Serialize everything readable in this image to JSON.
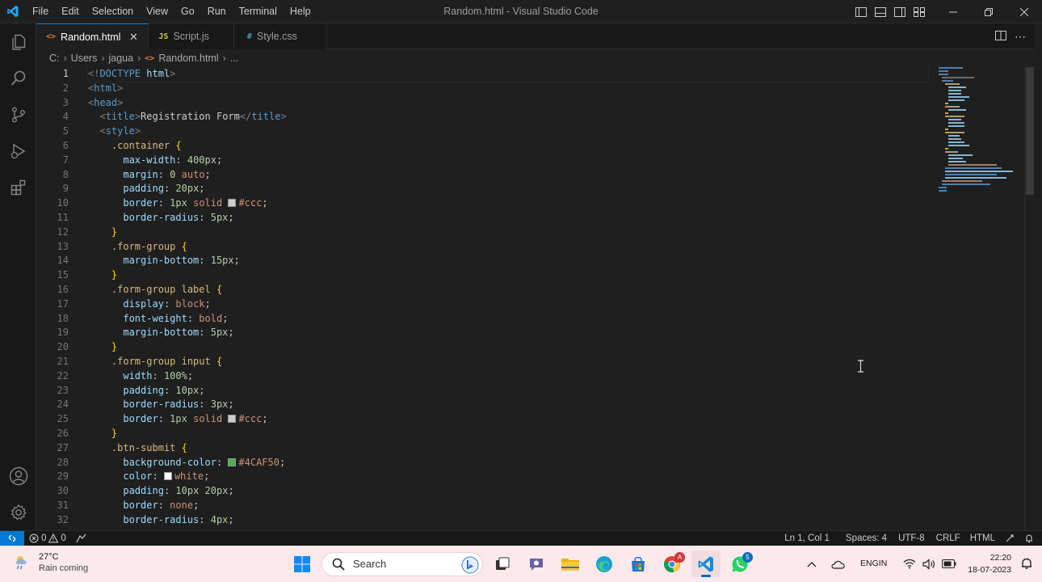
{
  "window": {
    "title": "Random.html - Visual Studio Code"
  },
  "menu": [
    "File",
    "Edit",
    "Selection",
    "View",
    "Go",
    "Run",
    "Terminal",
    "Help"
  ],
  "tabs": [
    {
      "label": "Random.html",
      "icon": "<>",
      "icon_color": "#e37933",
      "active": true
    },
    {
      "label": "Script.js",
      "icon": "JS",
      "icon_color": "#cbcb41",
      "active": false
    },
    {
      "label": "Style.css",
      "icon": "#",
      "icon_color": "#519aba",
      "active": false
    }
  ],
  "breadcrumb": {
    "drive": "C:",
    "users": "Users",
    "user": "jagua",
    "file": "Random.html",
    "more": "..."
  },
  "editor": {
    "line_numbers": [
      "1",
      "2",
      "3",
      "4",
      "5",
      "6",
      "7",
      "8",
      "9",
      "10",
      "11",
      "12",
      "13",
      "14",
      "15",
      "16",
      "17",
      "18",
      "19",
      "20",
      "21",
      "22",
      "23",
      "24",
      "25",
      "26",
      "27",
      "28",
      "29",
      "30",
      "31",
      "32"
    ],
    "current_line": 1
  },
  "colors": {
    "accent": "#0078d4",
    "tag": "#569cd6",
    "selector": "#d7ba7d",
    "property": "#9cdcfe",
    "value": "#ce9178",
    "number": "#b5cea8"
  },
  "statusbar": {
    "errors": "0",
    "warnings": "0",
    "position": "Ln 1, Col 1",
    "spaces": "Spaces: 4",
    "encoding": "UTF-8",
    "eol": "CRLF",
    "language": "HTML"
  },
  "taskbar": {
    "weather_temp": "27°C",
    "weather_desc": "Rain coming",
    "search_placeholder": "Search",
    "lang_1": "ENG",
    "lang_2": "IN",
    "time": "22:20",
    "date": "18-07-2023",
    "chrome_badge": "A",
    "whatsapp_badge": "5"
  }
}
